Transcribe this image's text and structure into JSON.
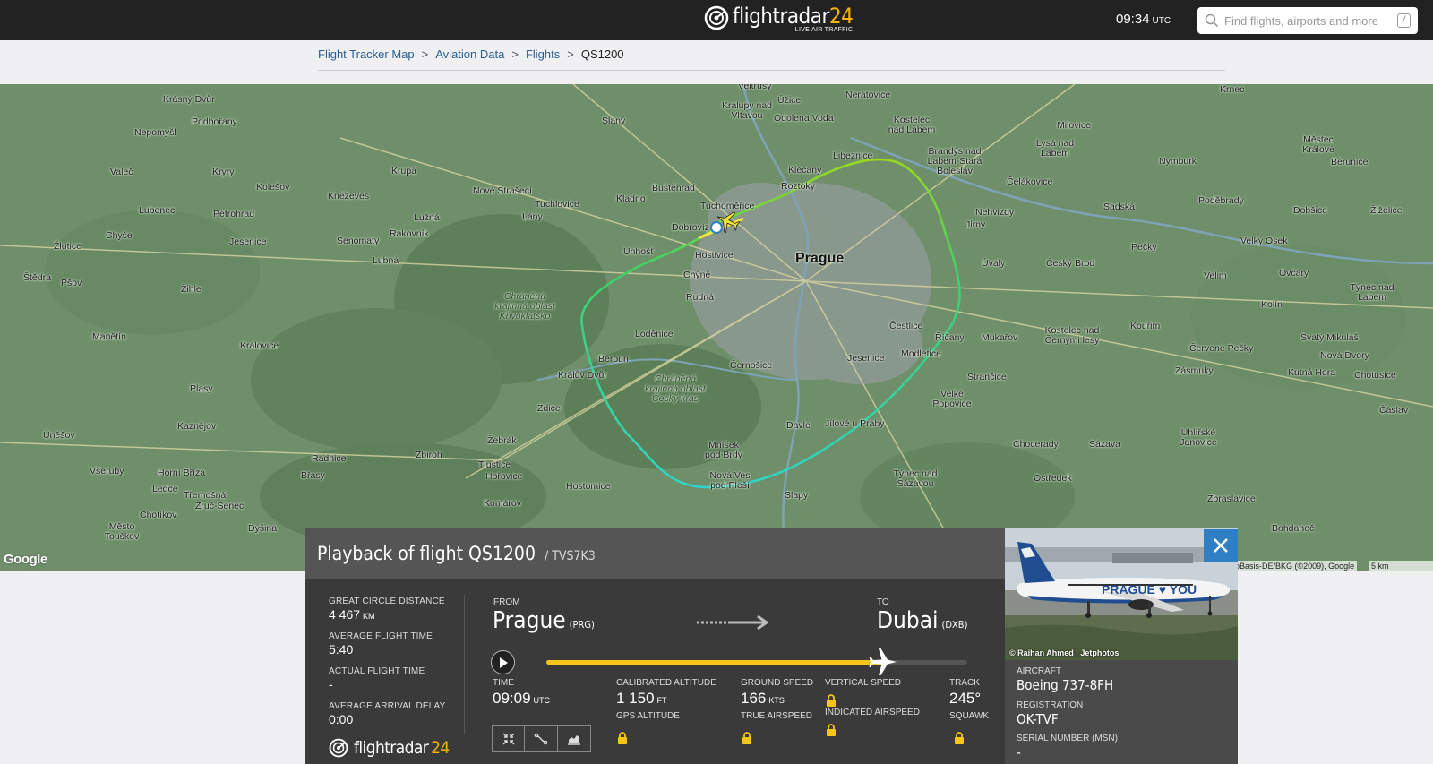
{
  "header": {
    "logo_name": "flightradar",
    "logo_number": "24",
    "logo_tagline": "LIVE AIR TRAFFIC",
    "clock_time": "09:34",
    "clock_zone": "UTC",
    "search_placeholder": "Find flights, airports and more",
    "search_shortcut": "/"
  },
  "breadcrumb": {
    "items": [
      "Flight Tracker Map",
      "Aviation Data",
      "Flights"
    ],
    "separator": ">",
    "current": "QS1200"
  },
  "map": {
    "main_city": "Prague",
    "labels": [
      "Krásný Dvůr",
      "Podbořany",
      "Nepomyšl",
      "Valeč",
      "Kryry",
      "Kolešov",
      "Krupá",
      "Nové Strašecí",
      "Slaný",
      "Veltrusy",
      "Neratovice",
      "Kralupy nad Vltavou",
      "Úžice",
      "Odolena Voda",
      "Kostelec nad Labem",
      "Milovice",
      "Krnec",
      "Lubenec",
      "Petrohrad",
      "Kněževes",
      "Lužná",
      "Tuchlovice",
      "Lány",
      "Buštěhrad",
      "Kladno",
      "Tuchoměřice",
      "Klecany",
      "Roztoky",
      "Libeznice",
      "Brandýs nad Labem-Stará Boleslav",
      "Lysá nad Labem",
      "Čelákovice",
      "Nymburk",
      "Městec Králové",
      "Běrunice",
      "Chyše",
      "Jesenice",
      "Senomaty",
      "Rakovník",
      "Dobrovíz",
      "Unhošť",
      "Hostivice",
      "Nehvizdy",
      "Jirny",
      "Sadská",
      "Poděbrady",
      "Dobšice",
      "Žiželice",
      "Žlutice",
      "Lubná",
      "Chýně",
      "Úvaly",
      "Český Brod",
      "Pečky",
      "Velký Osek",
      "Štědrá",
      "Pšov",
      "Žihle",
      "Rudná",
      "Velim",
      "Ovčáry",
      "Týnec nad Labem",
      "Manětín",
      "Kralovice",
      "Loděnice",
      "Čestlice",
      "Kostelec nad Černými lesy",
      "Kouřim",
      "Kolín",
      "Beroun",
      "Říčany",
      "Mukařov",
      "Červené Pečky",
      "Svatý Mikuláš",
      "Nová Dvory",
      "Králův Dvůr",
      "Černošice",
      "Jesenice",
      "Modletice",
      "Strančice",
      "Zásmuky",
      "Kutná Hora",
      "Chotusice",
      "Plasy",
      "Velké Popovice",
      "Čáslav",
      "Kaznějov",
      "Zdice",
      "Davle",
      "Jílové u Prahy",
      "Úněšov",
      "Žebrák",
      "Mníšek pod Brdy",
      "Chocerady",
      "Sázava",
      "Uhlířské Janovice",
      "Radnice",
      "Zbiroh",
      "Tlustice",
      "Hořovice",
      "Týnec nad Sázavou",
      "Ostředek",
      "Všeruby",
      "Horní Bříza",
      "Břasy",
      "Ledce",
      "Třemošná",
      "Zruč-Senec",
      "Hostomice",
      "Nová Ves pod Pleší",
      "Slapy",
      "Zbraslavice",
      "Chotíkov",
      "Komárov",
      "Město Touškov",
      "Dýšina",
      "Bohdaneč"
    ],
    "parks": [
      "Chráněná krajinná oblast Křivoklátsko",
      "Chráněná krajinná oblast Český kras"
    ],
    "google": "Google",
    "credit": "oBasis-DE/BKG (©2009), Google",
    "scale": "5 km"
  },
  "playback": {
    "title_prefix": "Playback of flight",
    "flight": "QS1200",
    "callsign": "/ TVS7K3",
    "stats": [
      {
        "label": "GREAT CIRCLE DISTANCE",
        "value": "4 467",
        "unit": "KM"
      },
      {
        "label": "AVERAGE FLIGHT TIME",
        "value": "5:40",
        "unit": ""
      },
      {
        "label": "ACTUAL FLIGHT TIME",
        "value": "-",
        "unit": ""
      },
      {
        "label": "AVERAGE ARRIVAL DELAY",
        "value": "0:00",
        "unit": ""
      }
    ],
    "from_label": "FROM",
    "from_city": "Prague",
    "from_code": "(PRG)",
    "to_label": "TO",
    "to_city": "Dubai",
    "to_code": "(DXB)",
    "progress": 0.8,
    "time_label": "TIME",
    "time_value": "09:09",
    "time_unit": "UTC",
    "cal_alt_label": "CALIBRATED ALTITUDE",
    "cal_alt_value": "1 150",
    "cal_alt_unit": "FT",
    "gps_alt_label": "GPS ALTITUDE",
    "ground_speed_label": "GROUND SPEED",
    "ground_speed_value": "166",
    "ground_speed_unit": "KTS",
    "true_airspeed_label": "TRUE AIRSPEED",
    "vertical_speed_label": "VERTICAL SPEED",
    "indicated_airspeed_label": "INDICATED AIRSPEED",
    "track_label": "TRACK",
    "track_value": "245°",
    "squawk_label": "SQUAWK"
  },
  "aircraft": {
    "photo_credit": "© Raihan Ahmed | Jetphotos",
    "livery_text": "PRAGUE ♥ YOU",
    "aircraft_label": "AIRCRAFT",
    "aircraft_value": "Boeing 737-8FH",
    "registration_label": "REGISTRATION",
    "registration_value": "OK-TVF",
    "serial_label": "SERIAL NUMBER (MSN)",
    "serial_value": "-"
  },
  "colors": {
    "topbar": "#222222",
    "accent_yellow": "#f5c518",
    "close_blue": "#2f7fc4",
    "map_green": "#6e8f6a"
  }
}
